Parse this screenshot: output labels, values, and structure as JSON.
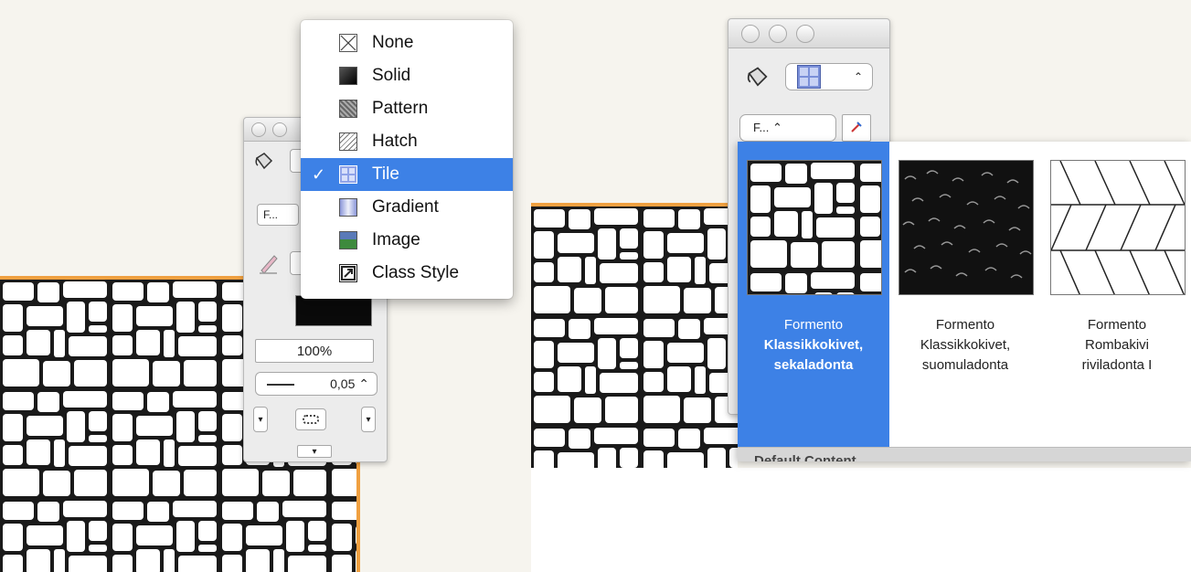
{
  "fill_menu": {
    "items": [
      {
        "label": "None",
        "icon": "none-fill-icon"
      },
      {
        "label": "Solid",
        "icon": "solid-fill-icon"
      },
      {
        "label": "Pattern",
        "icon": "pattern-fill-icon"
      },
      {
        "label": "Hatch",
        "icon": "hatch-fill-icon"
      },
      {
        "label": "Tile",
        "icon": "tile-fill-icon",
        "selected": true
      },
      {
        "label": "Gradient",
        "icon": "gradient-fill-icon"
      },
      {
        "label": "Image",
        "icon": "image-fill-icon"
      },
      {
        "label": "Class Style",
        "icon": "class-style-icon"
      }
    ],
    "check": "✓"
  },
  "left_palette": {
    "class_popup": "F...",
    "opacity": "100%",
    "line_weight": "0,05 ⌃",
    "line_style_icon": "line-style-icon",
    "disclosure": "▾"
  },
  "right_palette": {
    "class_popup": "F...  ⌃",
    "fill_popup_arrows": "⌃",
    "tools_icon": "resource-tools-icon"
  },
  "tile_library": {
    "tiles": [
      {
        "line1": "Formento",
        "line2": "Klassikkokivet,",
        "line3": "sekaladonta",
        "selected": true
      },
      {
        "line1": "Formento",
        "line2": "Klassikkokivet,",
        "line3": "suomuladonta",
        "selected": false
      },
      {
        "line1": "Formento",
        "line2": "Rombakivi",
        "line3": "riviladonta I",
        "selected": false
      }
    ],
    "footer": "Default Content"
  },
  "colors": {
    "selection": "#3d81e6",
    "accent_orange": "#f0a040",
    "background": "#f6f4ee"
  }
}
